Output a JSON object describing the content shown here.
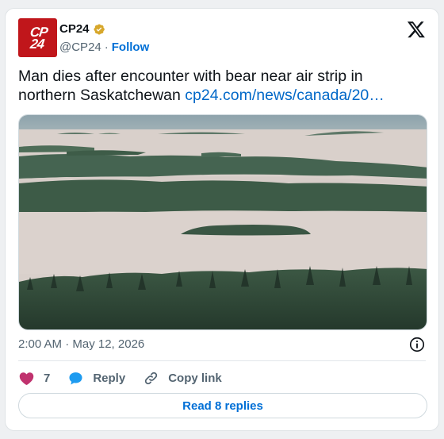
{
  "author": {
    "avatar_text_line1": "CP",
    "avatar_text_line2": "24",
    "display_name": "CP24",
    "handle": "@CP24",
    "separator": "·",
    "follow_label": "Follow",
    "verified_icon": "gold-verified-badge-icon"
  },
  "platform_icon": "x-logo-icon",
  "tweet": {
    "text": "Man dies after encounter with bear near air strip in northern Saskatchewan ",
    "link_text": "cp24.com/news/canada/20…"
  },
  "media": {
    "description_icon": "photo-lakes-forest",
    "colors": {
      "sky": "#8fa3ab",
      "water": "#d8cfc9",
      "forest_dark": "#2f4636",
      "forest_mid": "#4c6b55"
    }
  },
  "meta": {
    "timestamp": "2:00 AM · May 12, 2026",
    "info_icon": "info-icon"
  },
  "actions": {
    "like_count": "7",
    "reply_label": "Reply",
    "copy_link_label": "Copy link"
  },
  "read_replies_label": "Read 8 replies",
  "colors": {
    "brand_red": "#c0161b",
    "link_blue": "#006fd6",
    "like_pink": "#c0326e",
    "reply_blue": "#1d9bf0"
  }
}
